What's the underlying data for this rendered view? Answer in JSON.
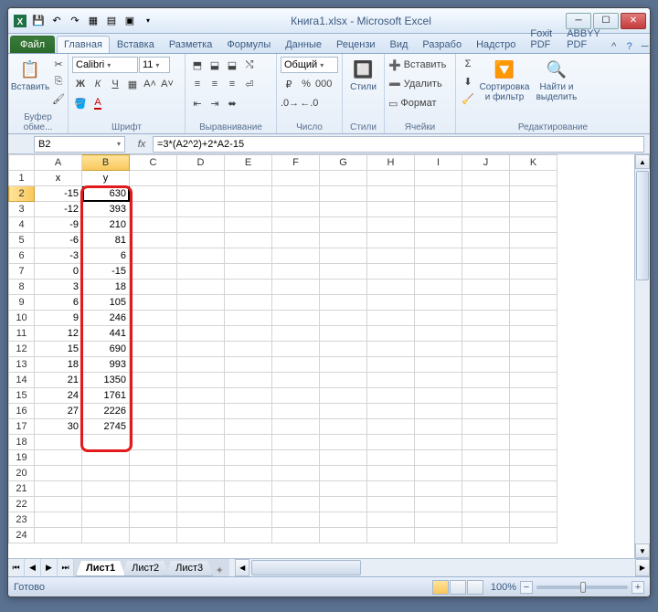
{
  "window": {
    "title": "Книга1.xlsx - Microsoft Excel"
  },
  "tabs": {
    "file": "Файл",
    "items": [
      "Главная",
      "Вставка",
      "Разметка",
      "Формулы",
      "Данные",
      "Рецензи",
      "Вид",
      "Разрабо",
      "Надстро",
      "Foxit PDF",
      "ABBYY PDF"
    ],
    "active_index": 0
  },
  "ribbon": {
    "clipboard": {
      "paste": "Вставить",
      "label": "Буфер обме..."
    },
    "font": {
      "name": "Calibri",
      "size": "11",
      "label": "Шрифт"
    },
    "alignment": {
      "label": "Выравнивание"
    },
    "number": {
      "format": "Общий",
      "label": "Число"
    },
    "styles": {
      "btn": "Стили",
      "label": "Стили"
    },
    "cells": {
      "insert": "Вставить",
      "delete": "Удалить",
      "format": "Формат",
      "label": "Ячейки"
    },
    "editing": {
      "sort": "Сортировка и фильтр",
      "find": "Найти и выделить",
      "label": "Редактирование"
    }
  },
  "formula_bar": {
    "name_box": "B2",
    "formula": "=3*(A2^2)+2*A2-15"
  },
  "grid": {
    "columns": [
      "A",
      "B",
      "C",
      "D",
      "E",
      "F",
      "G",
      "H",
      "I",
      "J",
      "K"
    ],
    "selected_col": "B",
    "row_count": 24,
    "header": {
      "A": "x",
      "B": "y"
    },
    "data": [
      {
        "row": 2,
        "A": -15,
        "B": 630
      },
      {
        "row": 3,
        "A": -12,
        "B": 393
      },
      {
        "row": 4,
        "A": -9,
        "B": 210
      },
      {
        "row": 5,
        "A": -6,
        "B": 81
      },
      {
        "row": 6,
        "A": -3,
        "B": 6
      },
      {
        "row": 7,
        "A": 0,
        "B": -15
      },
      {
        "row": 8,
        "A": 3,
        "B": 18
      },
      {
        "row": 9,
        "A": 6,
        "B": 105
      },
      {
        "row": 10,
        "A": 9,
        "B": 246
      },
      {
        "row": 11,
        "A": 12,
        "B": 441
      },
      {
        "row": 12,
        "A": 15,
        "B": 690
      },
      {
        "row": 13,
        "A": 18,
        "B": 993
      },
      {
        "row": 14,
        "A": 21,
        "B": 1350
      },
      {
        "row": 15,
        "A": 24,
        "B": 1761
      },
      {
        "row": 16,
        "A": 27,
        "B": 2226
      },
      {
        "row": 17,
        "A": 30,
        "B": 2745
      }
    ],
    "active_cell": "B2",
    "highlight": {
      "col": "B",
      "row_start": 2,
      "row_end": 17
    }
  },
  "sheets": {
    "items": [
      "Лист1",
      "Лист2",
      "Лист3"
    ],
    "active_index": 0
  },
  "status": {
    "ready": "Готово",
    "zoom": "100%"
  }
}
